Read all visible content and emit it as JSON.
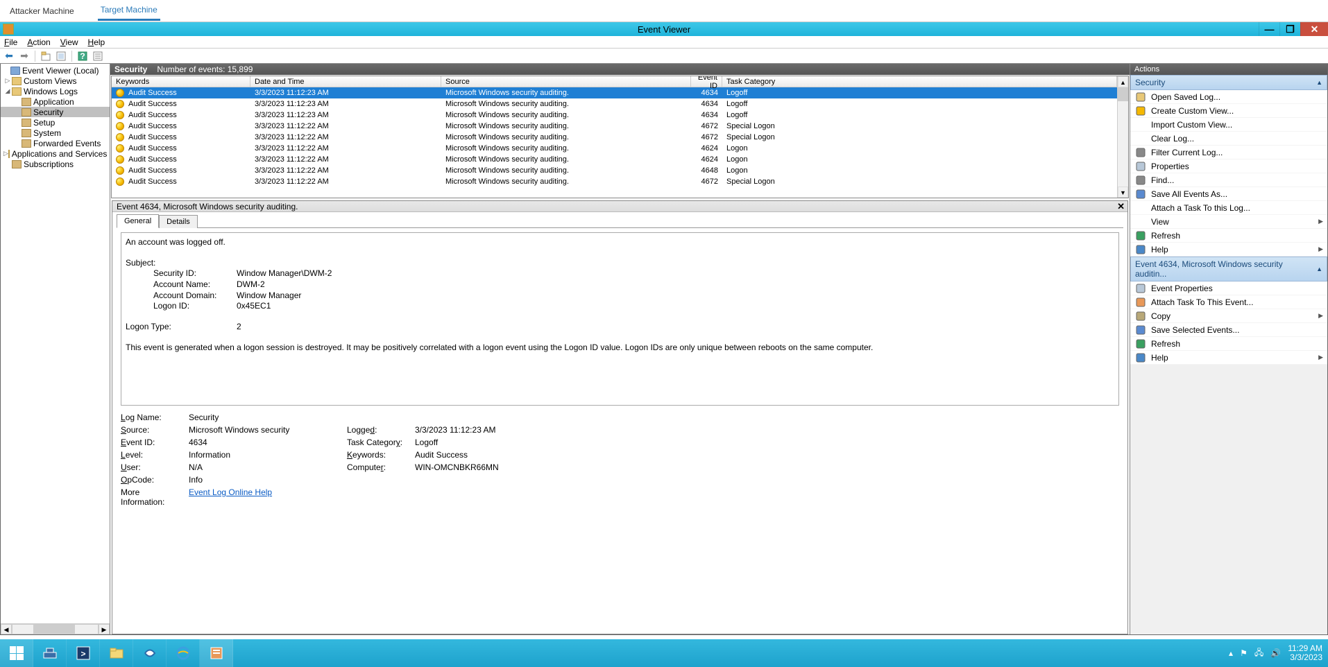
{
  "topTabs": {
    "attacker": "Attacker Machine",
    "target": "Target Machine"
  },
  "window": {
    "title": "Event Viewer"
  },
  "menu": {
    "file": "File",
    "action": "Action",
    "view": "View",
    "help": "Help"
  },
  "tree": {
    "root": "Event Viewer (Local)",
    "customViews": "Custom Views",
    "windowsLogs": "Windows Logs",
    "application": "Application",
    "security": "Security",
    "setup": "Setup",
    "system": "System",
    "forwarded": "Forwarded Events",
    "appsAndServices": "Applications and Services Lo",
    "subscriptions": "Subscriptions"
  },
  "centerHeader": {
    "title": "Security",
    "count": "Number of events: 15,899"
  },
  "columns": {
    "keywords": "Keywords",
    "datetime": "Date and Time",
    "source": "Source",
    "eventid": "Event ID",
    "taskcat": "Task Category"
  },
  "events": [
    {
      "k": "Audit Success",
      "dt": "3/3/2023 11:12:23 AM",
      "src": "Microsoft Windows security auditing.",
      "eid": "4634",
      "tc": "Logoff",
      "sel": true
    },
    {
      "k": "Audit Success",
      "dt": "3/3/2023 11:12:23 AM",
      "src": "Microsoft Windows security auditing.",
      "eid": "4634",
      "tc": "Logoff"
    },
    {
      "k": "Audit Success",
      "dt": "3/3/2023 11:12:23 AM",
      "src": "Microsoft Windows security auditing.",
      "eid": "4634",
      "tc": "Logoff"
    },
    {
      "k": "Audit Success",
      "dt": "3/3/2023 11:12:22 AM",
      "src": "Microsoft Windows security auditing.",
      "eid": "4672",
      "tc": "Special Logon"
    },
    {
      "k": "Audit Success",
      "dt": "3/3/2023 11:12:22 AM",
      "src": "Microsoft Windows security auditing.",
      "eid": "4672",
      "tc": "Special Logon"
    },
    {
      "k": "Audit Success",
      "dt": "3/3/2023 11:12:22 AM",
      "src": "Microsoft Windows security auditing.",
      "eid": "4624",
      "tc": "Logon"
    },
    {
      "k": "Audit Success",
      "dt": "3/3/2023 11:12:22 AM",
      "src": "Microsoft Windows security auditing.",
      "eid": "4624",
      "tc": "Logon"
    },
    {
      "k": "Audit Success",
      "dt": "3/3/2023 11:12:22 AM",
      "src": "Microsoft Windows security auditing.",
      "eid": "4648",
      "tc": "Logon"
    },
    {
      "k": "Audit Success",
      "dt": "3/3/2023 11:12:22 AM",
      "src": "Microsoft Windows security auditing.",
      "eid": "4672",
      "tc": "Special Logon"
    }
  ],
  "detailHeader": "Event 4634, Microsoft Windows security auditing.",
  "tabs": {
    "general": "General",
    "details": "Details"
  },
  "desc": {
    "line1": "An account was logged off.",
    "subject": "Subject:",
    "sid_l": "Security ID:",
    "sid_v": "Window Manager\\DWM-2",
    "an_l": "Account Name:",
    "an_v": "DWM-2",
    "ad_l": "Account Domain:",
    "ad_v": "Window Manager",
    "lid_l": "Logon ID:",
    "lid_v": "0x45EC1",
    "lt_l": "Logon Type:",
    "lt_v": "2",
    "explain": "This event is generated when a logon session is destroyed. It may be positively correlated with a logon event using the Logon ID value. Logon IDs are only unique between reboots on the same computer."
  },
  "kv": {
    "logname_l": "Log Name:",
    "logname_v": "Security",
    "source_l": "Source:",
    "source_v": "Microsoft Windows security",
    "logged_l": "Logged:",
    "logged_v": "3/3/2023 11:12:23 AM",
    "eventid_l": "Event ID:",
    "eventid_v": "4634",
    "taskcat_l": "Task Category:",
    "taskcat_v": "Logoff",
    "level_l": "Level:",
    "level_v": "Information",
    "keywords_l": "Keywords:",
    "keywords_v": "Audit Success",
    "user_l": "User:",
    "user_v": "N/A",
    "computer_l": "Computer:",
    "computer_v": "WIN-OMCNBKR66MN",
    "opcode_l": "OpCode:",
    "opcode_v": "Info",
    "moreinfo_l": "More Information:",
    "moreinfo_link": "Event Log Online Help"
  },
  "actionsTitle": "Actions",
  "actionGroup1": "Security",
  "actions1": [
    {
      "t": "Open Saved Log...",
      "i": "folder"
    },
    {
      "t": "Create Custom View...",
      "i": "sparkle"
    },
    {
      "t": "Import Custom View...",
      "i": ""
    },
    {
      "t": "Clear Log...",
      "i": ""
    },
    {
      "t": "Filter Current Log...",
      "i": "filter"
    },
    {
      "t": "Properties",
      "i": "props"
    },
    {
      "t": "Find...",
      "i": "find"
    },
    {
      "t": "Save All Events As...",
      "i": "save"
    },
    {
      "t": "Attach a Task To this Log...",
      "i": ""
    },
    {
      "t": "View",
      "i": "",
      "arrow": true
    },
    {
      "t": "Refresh",
      "i": "refresh"
    },
    {
      "t": "Help",
      "i": "help",
      "arrow": true
    }
  ],
  "actionGroup2": "Event 4634, Microsoft Windows security auditin...",
  "actions2": [
    {
      "t": "Event Properties",
      "i": "props"
    },
    {
      "t": "Attach Task To This Event...",
      "i": "task"
    },
    {
      "t": "Copy",
      "i": "copy",
      "arrow": true
    },
    {
      "t": "Save Selected Events...",
      "i": "save"
    },
    {
      "t": "Refresh",
      "i": "refresh"
    },
    {
      "t": "Help",
      "i": "help",
      "arrow": true
    }
  ],
  "tray": {
    "time": "11:29 AM",
    "date": "3/3/2023"
  }
}
